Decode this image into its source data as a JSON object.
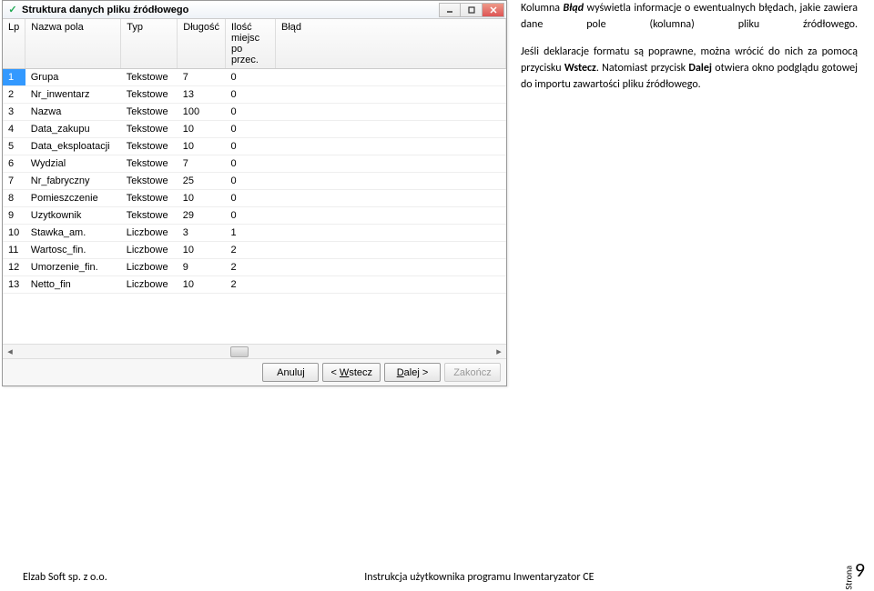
{
  "window": {
    "title": "Struktura danych pliku źródłowego",
    "icon": "✓"
  },
  "columns": {
    "lp": "Lp",
    "name": "Nazwa pola",
    "type": "Typ",
    "length": "Długość",
    "decimals": "Ilość miejsc po przec.",
    "error": "Błąd"
  },
  "rows": [
    {
      "lp": "1",
      "name": "Grupa",
      "type": "Tekstowe",
      "len": "7",
      "dec": "0"
    },
    {
      "lp": "2",
      "name": "Nr_inwentarz",
      "type": "Tekstowe",
      "len": "13",
      "dec": "0"
    },
    {
      "lp": "3",
      "name": "Nazwa",
      "type": "Tekstowe",
      "len": "100",
      "dec": "0"
    },
    {
      "lp": "4",
      "name": "Data_zakupu",
      "type": "Tekstowe",
      "len": "10",
      "dec": "0"
    },
    {
      "lp": "5",
      "name": "Data_eksploatacji",
      "type": "Tekstowe",
      "len": "10",
      "dec": "0"
    },
    {
      "lp": "6",
      "name": "Wydzial",
      "type": "Tekstowe",
      "len": "7",
      "dec": "0"
    },
    {
      "lp": "7",
      "name": "Nr_fabryczny",
      "type": "Tekstowe",
      "len": "25",
      "dec": "0"
    },
    {
      "lp": "8",
      "name": "Pomieszczenie",
      "type": "Tekstowe",
      "len": "10",
      "dec": "0"
    },
    {
      "lp": "9",
      "name": "Uzytkownik",
      "type": "Tekstowe",
      "len": "29",
      "dec": "0"
    },
    {
      "lp": "10",
      "name": "Stawka_am.",
      "type": "Liczbowe",
      "len": "3",
      "dec": "1"
    },
    {
      "lp": "11",
      "name": "Wartosc_fin.",
      "type": "Liczbowe",
      "len": "10",
      "dec": "2"
    },
    {
      "lp": "12",
      "name": "Umorzenie_fin.",
      "type": "Liczbowe",
      "len": "9",
      "dec": "2"
    },
    {
      "lp": "13",
      "name": "Netto_fin",
      "type": "Liczbowe",
      "len": "10",
      "dec": "2"
    }
  ],
  "buttons": {
    "cancel": "Anuluj",
    "back": "< Wstecz",
    "next": "Dalej >",
    "finish": "Zakończ"
  },
  "side": {
    "p1a": "Kolumna ",
    "p1b": "Błąd",
    "p1c": " wyświetla informacje o ewentualnych błędach, jakie zawiera dane pole (kolumna) pliku źródłowego.",
    "p2a": "Jeśli deklaracje formatu są poprawne, można wrócić do nich za pomocą przycisku ",
    "p2b": "Wstecz",
    "p2c": ". Natomiast przycisk ",
    "p2d": "Dalej",
    "p2e": " otwiera okno podglądu gotowej do importu zawartości pliku źródłowego."
  },
  "footer": {
    "left": "Elzab Soft sp. z o.o.",
    "center": "Instrukcja użytkownika programu Inwentaryzator CE",
    "page_label": "Strona",
    "page_num": "9"
  }
}
